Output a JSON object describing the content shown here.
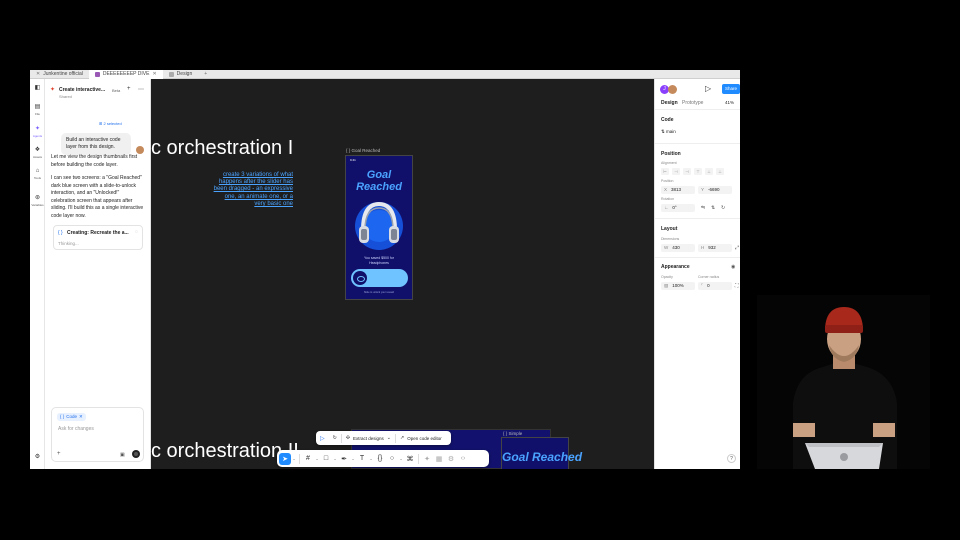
{
  "browser": {
    "tabs": [
      {
        "label": "Junkentine official",
        "active": false
      },
      {
        "label": "DEEEEEEEEP DIVE",
        "active": true
      },
      {
        "label": "Design",
        "active": false
      }
    ],
    "new_tab": "+"
  },
  "rail": {
    "items": [
      {
        "label": "File",
        "icon": "file-icon"
      },
      {
        "label": "Agents",
        "icon": "agents-icon"
      },
      {
        "label": "Assets",
        "icon": "assets-icon"
      },
      {
        "label": "Tools",
        "icon": "tools-icon"
      },
      {
        "label": "Variables",
        "icon": "variables-icon"
      }
    ]
  },
  "chat": {
    "title": "Create interactive...",
    "subtitle": "Shared",
    "beta": "Beta",
    "selected_badge": "2 selected",
    "user_message": "Build an interactive code layer from this design.",
    "ai_message_1": "Let me view the design thumbnails first before building the code layer.",
    "ai_message_2": "I can see two screens: a \"Goal Reached\" dark blue screen with a slide-to-unlock interaction, and an \"Unlocked!\" celebration screen that appears after sliding. I'll build this as a single interactive code layer now.",
    "task_label": "Creating: Recreate the a...",
    "task_status": "Thinking...",
    "chip_label": "Code",
    "input_placeholder": "Ask for changes"
  },
  "canvas": {
    "section_title_1": "c orchestration I",
    "section_title_2": "c orchestration II",
    "note": "create 3 variations of what happens after the slider has been dragged - an expressive one, an animate one, or a very basic one",
    "frame_label": "Goal Reached",
    "phone": {
      "time": "9:41",
      "title": "Goal Reached",
      "saved_text": "You saved $500 for Headphones",
      "footer": "Slide to unlock your reward"
    },
    "simple_label": "Simple",
    "simple_title": "Goal Reached"
  },
  "ai_bar": {
    "extract": "Extract designs",
    "open_editor": "Open code editor"
  },
  "properties": {
    "avatar_initial": "J",
    "share": "Share",
    "tab_design": "Design",
    "tab_prototype": "Prototype",
    "zoom": "41%",
    "code_section": "Code",
    "code_layer": "main",
    "position_section": "Position",
    "alignment_label": "Alignment",
    "position_label": "Position",
    "x_key": "X",
    "x_value": "3813",
    "y_key": "Y",
    "y_value": "-6690",
    "rotation_label": "Rotation",
    "rotation_value": "0°",
    "layout_section": "Layout",
    "dimensions_label": "Dimensions",
    "w_key": "W",
    "w_value": "430",
    "h_key": "H",
    "h_value": "932",
    "appearance_section": "Appearance",
    "opacity_label": "Opacity",
    "opacity_value": "100%",
    "radius_label": "Corner radius",
    "radius_value": "0",
    "help": "?"
  },
  "colors": {
    "accent": "#1f8bff",
    "phone_bg": "#10106b",
    "goal_text": "#4aa3ff",
    "slider": "#6fc3ff"
  }
}
